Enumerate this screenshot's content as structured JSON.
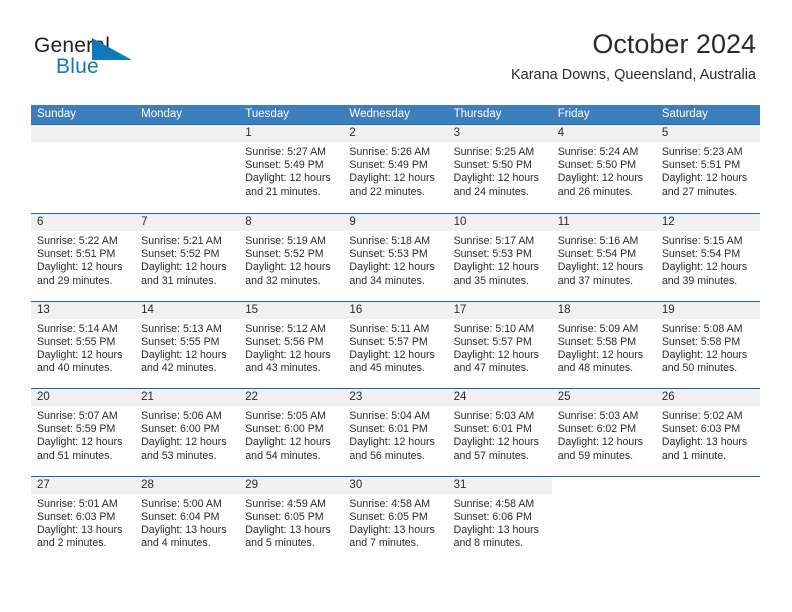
{
  "logo": {
    "word_one": "General",
    "word_two": "Blue",
    "triangle_icon": "triangle-logo-icon",
    "brand_blue": "#1278be",
    "brand_dark": "#231f20"
  },
  "header": {
    "title": "October 2024",
    "location": "Karana Downs, Queensland, Australia"
  },
  "theme": {
    "header_blue": "#3d7ebd",
    "week_divider_blue": "#2166ab",
    "daynum_band": "#f0f0f0",
    "text": "#2b2b2b"
  },
  "weekdays": [
    "Sunday",
    "Monday",
    "Tuesday",
    "Wednesday",
    "Thursday",
    "Friday",
    "Saturday"
  ],
  "weeks": [
    [
      {
        "day": "",
        "sunrise": "",
        "sunset": "",
        "daylight_line1": "",
        "daylight_line2": "",
        "empty": true
      },
      {
        "day": "",
        "sunrise": "",
        "sunset": "",
        "daylight_line1": "",
        "daylight_line2": "",
        "empty": true
      },
      {
        "day": "1",
        "sunrise": "Sunrise: 5:27 AM",
        "sunset": "Sunset: 5:49 PM",
        "daylight_line1": "Daylight: 12 hours",
        "daylight_line2": "and 21 minutes."
      },
      {
        "day": "2",
        "sunrise": "Sunrise: 5:26 AM",
        "sunset": "Sunset: 5:49 PM",
        "daylight_line1": "Daylight: 12 hours",
        "daylight_line2": "and 22 minutes."
      },
      {
        "day": "3",
        "sunrise": "Sunrise: 5:25 AM",
        "sunset": "Sunset: 5:50 PM",
        "daylight_line1": "Daylight: 12 hours",
        "daylight_line2": "and 24 minutes."
      },
      {
        "day": "4",
        "sunrise": "Sunrise: 5:24 AM",
        "sunset": "Sunset: 5:50 PM",
        "daylight_line1": "Daylight: 12 hours",
        "daylight_line2": "and 26 minutes."
      },
      {
        "day": "5",
        "sunrise": "Sunrise: 5:23 AM",
        "sunset": "Sunset: 5:51 PM",
        "daylight_line1": "Daylight: 12 hours",
        "daylight_line2": "and 27 minutes."
      }
    ],
    [
      {
        "day": "6",
        "sunrise": "Sunrise: 5:22 AM",
        "sunset": "Sunset: 5:51 PM",
        "daylight_line1": "Daylight: 12 hours",
        "daylight_line2": "and 29 minutes."
      },
      {
        "day": "7",
        "sunrise": "Sunrise: 5:21 AM",
        "sunset": "Sunset: 5:52 PM",
        "daylight_line1": "Daylight: 12 hours",
        "daylight_line2": "and 31 minutes."
      },
      {
        "day": "8",
        "sunrise": "Sunrise: 5:19 AM",
        "sunset": "Sunset: 5:52 PM",
        "daylight_line1": "Daylight: 12 hours",
        "daylight_line2": "and 32 minutes."
      },
      {
        "day": "9",
        "sunrise": "Sunrise: 5:18 AM",
        "sunset": "Sunset: 5:53 PM",
        "daylight_line1": "Daylight: 12 hours",
        "daylight_line2": "and 34 minutes."
      },
      {
        "day": "10",
        "sunrise": "Sunrise: 5:17 AM",
        "sunset": "Sunset: 5:53 PM",
        "daylight_line1": "Daylight: 12 hours",
        "daylight_line2": "and 35 minutes."
      },
      {
        "day": "11",
        "sunrise": "Sunrise: 5:16 AM",
        "sunset": "Sunset: 5:54 PM",
        "daylight_line1": "Daylight: 12 hours",
        "daylight_line2": "and 37 minutes."
      },
      {
        "day": "12",
        "sunrise": "Sunrise: 5:15 AM",
        "sunset": "Sunset: 5:54 PM",
        "daylight_line1": "Daylight: 12 hours",
        "daylight_line2": "and 39 minutes."
      }
    ],
    [
      {
        "day": "13",
        "sunrise": "Sunrise: 5:14 AM",
        "sunset": "Sunset: 5:55 PM",
        "daylight_line1": "Daylight: 12 hours",
        "daylight_line2": "and 40 minutes."
      },
      {
        "day": "14",
        "sunrise": "Sunrise: 5:13 AM",
        "sunset": "Sunset: 5:55 PM",
        "daylight_line1": "Daylight: 12 hours",
        "daylight_line2": "and 42 minutes."
      },
      {
        "day": "15",
        "sunrise": "Sunrise: 5:12 AM",
        "sunset": "Sunset: 5:56 PM",
        "daylight_line1": "Daylight: 12 hours",
        "daylight_line2": "and 43 minutes."
      },
      {
        "day": "16",
        "sunrise": "Sunrise: 5:11 AM",
        "sunset": "Sunset: 5:57 PM",
        "daylight_line1": "Daylight: 12 hours",
        "daylight_line2": "and 45 minutes."
      },
      {
        "day": "17",
        "sunrise": "Sunrise: 5:10 AM",
        "sunset": "Sunset: 5:57 PM",
        "daylight_line1": "Daylight: 12 hours",
        "daylight_line2": "and 47 minutes."
      },
      {
        "day": "18",
        "sunrise": "Sunrise: 5:09 AM",
        "sunset": "Sunset: 5:58 PM",
        "daylight_line1": "Daylight: 12 hours",
        "daylight_line2": "and 48 minutes."
      },
      {
        "day": "19",
        "sunrise": "Sunrise: 5:08 AM",
        "sunset": "Sunset: 5:58 PM",
        "daylight_line1": "Daylight: 12 hours",
        "daylight_line2": "and 50 minutes."
      }
    ],
    [
      {
        "day": "20",
        "sunrise": "Sunrise: 5:07 AM",
        "sunset": "Sunset: 5:59 PM",
        "daylight_line1": "Daylight: 12 hours",
        "daylight_line2": "and 51 minutes."
      },
      {
        "day": "21",
        "sunrise": "Sunrise: 5:06 AM",
        "sunset": "Sunset: 6:00 PM",
        "daylight_line1": "Daylight: 12 hours",
        "daylight_line2": "and 53 minutes."
      },
      {
        "day": "22",
        "sunrise": "Sunrise: 5:05 AM",
        "sunset": "Sunset: 6:00 PM",
        "daylight_line1": "Daylight: 12 hours",
        "daylight_line2": "and 54 minutes."
      },
      {
        "day": "23",
        "sunrise": "Sunrise: 5:04 AM",
        "sunset": "Sunset: 6:01 PM",
        "daylight_line1": "Daylight: 12 hours",
        "daylight_line2": "and 56 minutes."
      },
      {
        "day": "24",
        "sunrise": "Sunrise: 5:03 AM",
        "sunset": "Sunset: 6:01 PM",
        "daylight_line1": "Daylight: 12 hours",
        "daylight_line2": "and 57 minutes."
      },
      {
        "day": "25",
        "sunrise": "Sunrise: 5:03 AM",
        "sunset": "Sunset: 6:02 PM",
        "daylight_line1": "Daylight: 12 hours",
        "daylight_line2": "and 59 minutes."
      },
      {
        "day": "26",
        "sunrise": "Sunrise: 5:02 AM",
        "sunset": "Sunset: 6:03 PM",
        "daylight_line1": "Daylight: 13 hours",
        "daylight_line2": "and 1 minute."
      }
    ],
    [
      {
        "day": "27",
        "sunrise": "Sunrise: 5:01 AM",
        "sunset": "Sunset: 6:03 PM",
        "daylight_line1": "Daylight: 13 hours",
        "daylight_line2": "and 2 minutes."
      },
      {
        "day": "28",
        "sunrise": "Sunrise: 5:00 AM",
        "sunset": "Sunset: 6:04 PM",
        "daylight_line1": "Daylight: 13 hours",
        "daylight_line2": "and 4 minutes."
      },
      {
        "day": "29",
        "sunrise": "Sunrise: 4:59 AM",
        "sunset": "Sunset: 6:05 PM",
        "daylight_line1": "Daylight: 13 hours",
        "daylight_line2": "and 5 minutes."
      },
      {
        "day": "30",
        "sunrise": "Sunrise: 4:58 AM",
        "sunset": "Sunset: 6:05 PM",
        "daylight_line1": "Daylight: 13 hours",
        "daylight_line2": "and 7 minutes."
      },
      {
        "day": "31",
        "sunrise": "Sunrise: 4:58 AM",
        "sunset": "Sunset: 6:06 PM",
        "daylight_line1": "Daylight: 13 hours",
        "daylight_line2": "and 8 minutes."
      },
      {
        "day": "",
        "sunrise": "",
        "sunset": "",
        "daylight_line1": "",
        "daylight_line2": "",
        "blank": true
      },
      {
        "day": "",
        "sunrise": "",
        "sunset": "",
        "daylight_line1": "",
        "daylight_line2": "",
        "blank": true
      }
    ]
  ]
}
